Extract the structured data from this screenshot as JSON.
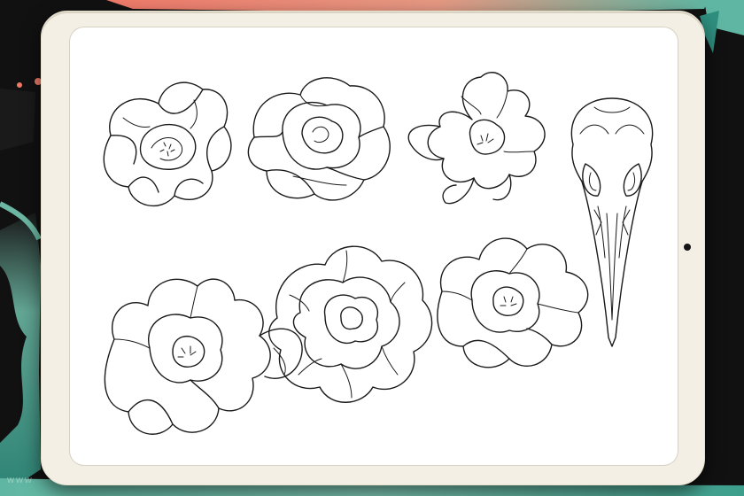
{
  "watermark_text": "www",
  "colors": {
    "background": "#111111",
    "brush_coral": "#f07a6a",
    "brush_teal": "#5fb6a2",
    "tablet_frame": "#f3efe4",
    "screen": "#ffffff",
    "ink": "#1a1a1a"
  },
  "artwork": {
    "items": [
      {
        "name": "peony-bloom-1",
        "icon": "flower-line-art-icon"
      },
      {
        "name": "rose-bloom",
        "icon": "flower-line-art-icon"
      },
      {
        "name": "peony-bloom-2",
        "icon": "flower-line-art-icon"
      },
      {
        "name": "bird-skull",
        "icon": "skull-line-art-icon"
      },
      {
        "name": "peony-side-view",
        "icon": "flower-line-art-icon"
      },
      {
        "name": "chrysanthemum-bloom",
        "icon": "flower-line-art-icon"
      },
      {
        "name": "peony-bloom-3",
        "icon": "flower-line-art-icon"
      }
    ]
  }
}
